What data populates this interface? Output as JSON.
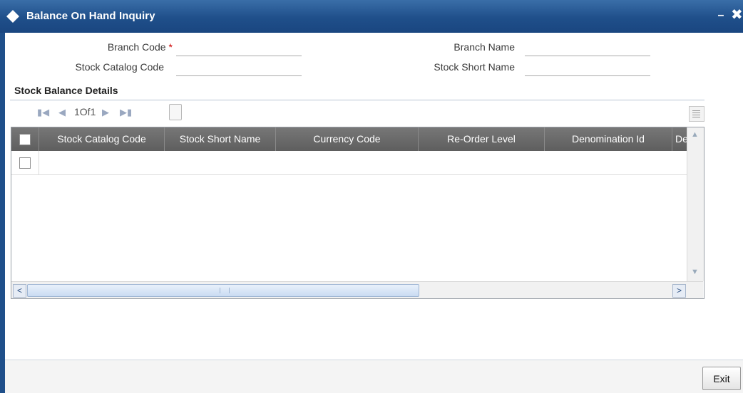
{
  "window": {
    "title": "Balance On Hand Inquiry",
    "minimize_glyph": "–",
    "close_glyph": "✖"
  },
  "form": {
    "branch_code_label": "Branch Code",
    "required_marker": "*",
    "branch_code_value": "",
    "branch_name_label": "Branch Name",
    "branch_name_value": "",
    "stock_catalog_code_label": "Stock Catalog Code",
    "stock_catalog_code_value": "",
    "stock_short_name_label": "Stock Short Name",
    "stock_short_name_value": ""
  },
  "section": {
    "title": "Stock Balance Details"
  },
  "pager": {
    "first_glyph": "▏◀",
    "prev_glyph": "◀",
    "page_text": "1Of1",
    "next_glyph": "▶",
    "last_glyph": "▶▕"
  },
  "grid": {
    "columns": [
      "Stock Catalog Code",
      "Stock Short Name",
      "Currency Code",
      "Re-Order Level",
      "Denomination Id",
      "De"
    ],
    "rows": [
      [
        "",
        "",
        "",
        "",
        "",
        ""
      ]
    ],
    "scroll_left_glyph": "<",
    "scroll_right_glyph": ">",
    "scroll_up_glyph": "^",
    "scroll_down_glyph": "v"
  },
  "footer": {
    "exit_label": "Exit"
  },
  "colors": {
    "titlebar": "#1f4f8a",
    "header": "#666666",
    "required": "#cc0000"
  }
}
